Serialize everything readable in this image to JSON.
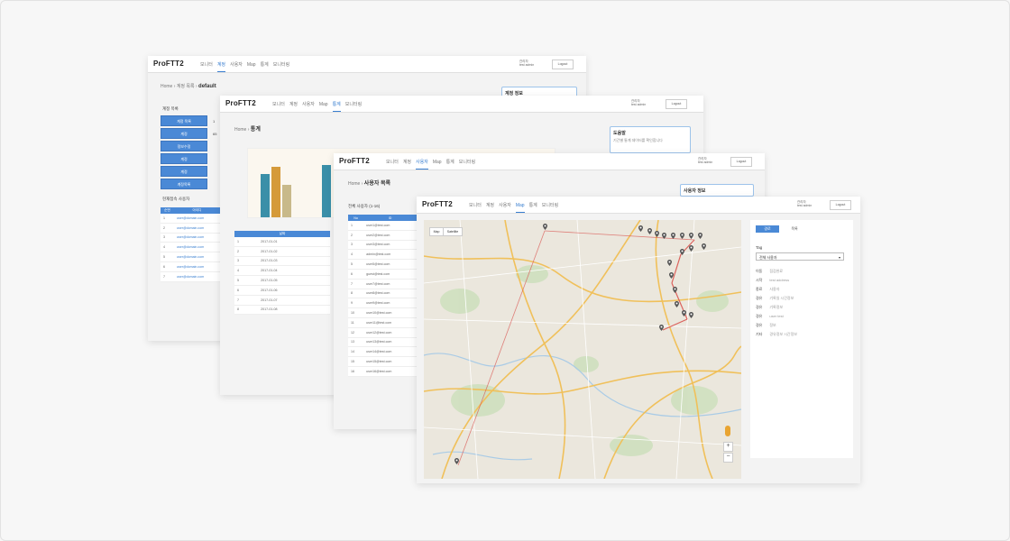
{
  "app": {
    "logo": "ProFTT2",
    "menu": [
      "모니터",
      "계정",
      "사용자",
      "Map",
      "통계",
      "모니터링"
    ],
    "user_line1": "관리자",
    "user_line2": "test admin",
    "logout": "Logout"
  },
  "win1": {
    "breadcrumb_home": "Home",
    "breadcrumb_mid": "계정 목록",
    "breadcrumb_current": "default",
    "side_title": "계정 목록",
    "side_buttons": [
      "계정 목록",
      "계정",
      "정보수정",
      "계정",
      "계정",
      "계정목록"
    ],
    "side_values": [
      "1",
      "65",
      "",
      "",
      "",
      ""
    ],
    "list_title": "현재접속 사용자",
    "table_headers": [
      "순번",
      "아이디"
    ],
    "table_rows": [
      [
        "1",
        "user@domain.com"
      ],
      [
        "2",
        "user@domain.com"
      ],
      [
        "3",
        "user@domain.com"
      ],
      [
        "4",
        "user@domain.com"
      ],
      [
        "5",
        "user@domain.com"
      ],
      [
        "6",
        "user@domain.com"
      ],
      [
        "7",
        "user@domain.com"
      ]
    ],
    "infobox_title": "계정 정보"
  },
  "win2": {
    "breadcrumb_home": "Home",
    "breadcrumb_current": "통계",
    "infobox_title": "도움말",
    "infobox_text": "기간별 통계 데이터를 확인합니다",
    "table_header": "날짜",
    "table_rows": [
      [
        "1",
        "2017-01-01"
      ],
      [
        "2",
        "2017-01-02"
      ],
      [
        "3",
        "2017-01-03"
      ],
      [
        "4",
        "2017-01-04"
      ],
      [
        "5",
        "2017-01-05"
      ],
      [
        "6",
        "2017-01-06"
      ],
      [
        "7",
        "2017-01-07"
      ],
      [
        "8",
        "2017-01-08"
      ]
    ],
    "chart_colors": [
      "#3a8fa8",
      "#d59a3a",
      "#c8b98a"
    ]
  },
  "win3": {
    "breadcrumb_home": "Home",
    "breadcrumb_current": "사용자 목록",
    "list_title": "전체 사용자 (1-16)",
    "infobox_title": "사용자 정보",
    "table_headers": [
      "No",
      "ID"
    ],
    "table_rows": [
      [
        "1",
        "user1@test.com"
      ],
      [
        "2",
        "user2@test.com"
      ],
      [
        "3",
        "user3@test.com"
      ],
      [
        "4",
        "admin@test.com"
      ],
      [
        "5",
        "user5@test.com"
      ],
      [
        "6",
        "guest@test.com"
      ],
      [
        "7",
        "user7@test.com"
      ],
      [
        "8",
        "user8@test.com"
      ],
      [
        "9",
        "user9@test.com"
      ],
      [
        "10",
        "user10@test.com"
      ],
      [
        "11",
        "user11@test.com"
      ],
      [
        "12",
        "user12@test.com"
      ],
      [
        "13",
        "user13@test.com"
      ],
      [
        "14",
        "user14@test.com"
      ],
      [
        "15",
        "user15@test.com"
      ],
      [
        "16",
        "user16@test.com"
      ]
    ]
  },
  "win4": {
    "map_buttons": [
      "Map",
      "Satellite"
    ],
    "zoom_in": "+",
    "zoom_out": "−",
    "panel_tabs": [
      "경로",
      "목록"
    ],
    "panel_label": "Tag",
    "panel_select": "전체 사용자",
    "panel_items": [
      {
        "key": "이동",
        "value": "점검완료"
      },
      {
        "key": "시작",
        "value": "test address"
      },
      {
        "key": "종료",
        "value": "사용자"
      },
      {
        "key": "경유",
        "value": "기록일 시간정보"
      },
      {
        "key": "경유",
        "value": "기록정보"
      },
      {
        "key": "경유",
        "value": "user test"
      },
      {
        "key": "경유",
        "value": "정보"
      },
      {
        "key": "기타",
        "value": "경유정보 시간정보"
      }
    ],
    "route_color": "#d9534f",
    "active_color": "#4a89d6"
  }
}
